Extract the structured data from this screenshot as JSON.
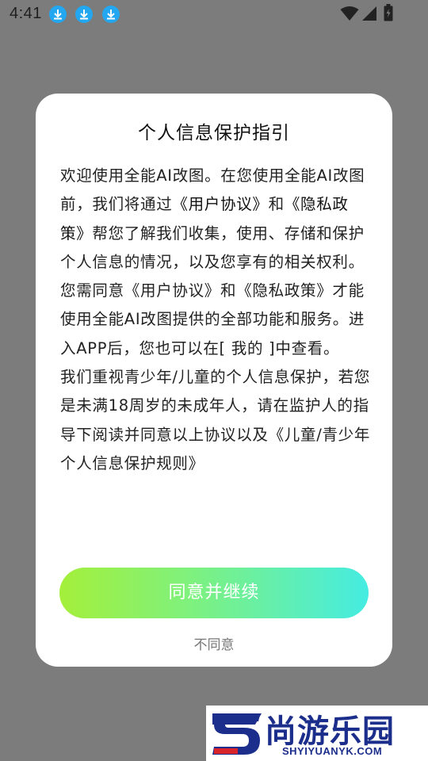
{
  "status_bar": {
    "time": "4:41",
    "icons": [
      "download-notification-icon",
      "download-notification-icon",
      "download-notification-icon",
      "wifi-icon",
      "cellular-signal-icon",
      "battery-charging-icon"
    ]
  },
  "dialog": {
    "title": "个人信息保护指引",
    "paragraph1": {
      "part1": "欢迎使用全能AI改图。在您使用全能AI改图前，我们将通过",
      "user_agreement": "《用户协议》",
      "part2": "和",
      "privacy_policy": "《隐私政策》",
      "part3": "帮您了解我们收集，使用、存储和保护个人信息的情况，以及您享有的相关权利。您需同意《用户协议》和《隐私政策》才能使用全能AI改图提供的全部功能和服务。进入APP后，您也可以在[ 我的 ]中查看。"
    },
    "paragraph2": "我们重视青少年/儿童的个人信息保护，若您是未满18周岁的未成年人，请在监护人的指导下阅读并同意以上协议以及《儿童/青少年个人信息保护规则》",
    "agree_label": "同意并继续",
    "disagree_label": "不同意"
  },
  "watermark": {
    "title": "尚游乐园",
    "url": "SHYIYUANYK.COM",
    "brand_color": "#1c2e8c",
    "accent_color": "#d8242a"
  },
  "colors": {
    "overlay": "#7b7c7b",
    "button_gradient_start": "#a4ef3a",
    "button_gradient_end": "#45ece2"
  }
}
